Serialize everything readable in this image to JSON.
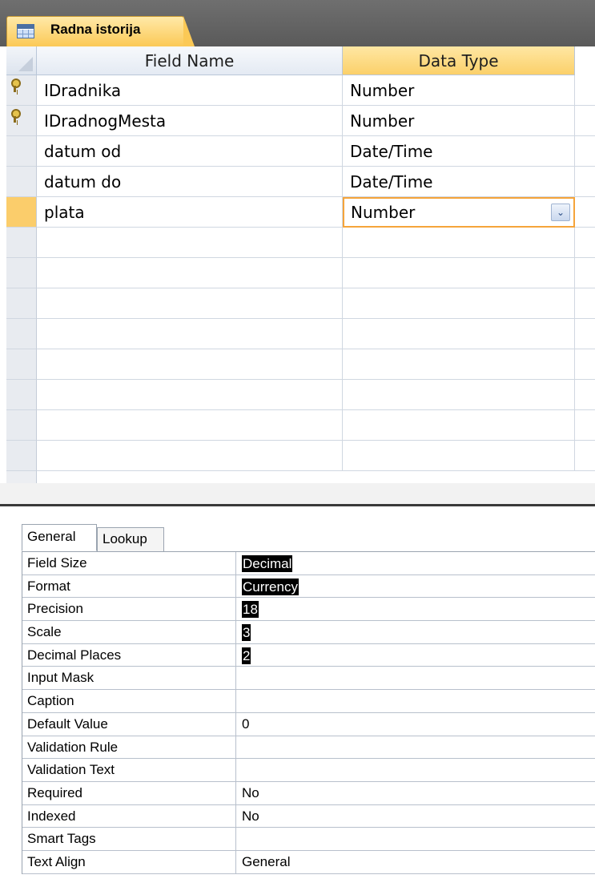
{
  "document_tab": {
    "title": "Radna istorija",
    "icon": "table-icon"
  },
  "grid": {
    "headers": {
      "field_name": "Field Name",
      "data_type": "Data Type"
    },
    "rows": [
      {
        "field": "IDradnika",
        "type": "Number",
        "primary_key": true
      },
      {
        "field": "IDradnogMesta",
        "type": "Number",
        "primary_key": true
      },
      {
        "field": "datum od",
        "type": "Date/Time",
        "primary_key": false
      },
      {
        "field": "datum do",
        "type": "Date/Time",
        "primary_key": false
      },
      {
        "field": "plata",
        "type": "Number",
        "primary_key": false,
        "selected": true
      }
    ]
  },
  "properties": {
    "tabs": {
      "general": "General",
      "lookup": "Lookup"
    },
    "rows": [
      {
        "name": "Field Size",
        "value": "Decimal",
        "highlighted": true
      },
      {
        "name": "Format",
        "value": "Currency",
        "highlighted": true
      },
      {
        "name": "Precision",
        "value": "18",
        "highlighted": true
      },
      {
        "name": "Scale",
        "value": "3",
        "highlighted": true
      },
      {
        "name": "Decimal Places",
        "value": "2",
        "highlighted": true
      },
      {
        "name": "Input Mask",
        "value": ""
      },
      {
        "name": "Caption",
        "value": ""
      },
      {
        "name": "Default Value",
        "value": "0"
      },
      {
        "name": "Validation Rule",
        "value": ""
      },
      {
        "name": "Validation Text",
        "value": ""
      },
      {
        "name": "Required",
        "value": "No"
      },
      {
        "name": "Indexed",
        "value": "No"
      },
      {
        "name": "Smart Tags",
        "value": ""
      },
      {
        "name": "Text Align",
        "value": "General"
      }
    ]
  },
  "colors": {
    "accent": "#fbcd6b",
    "selection_border": "#f5a43a",
    "tab_strip": "#5a5a5a"
  }
}
